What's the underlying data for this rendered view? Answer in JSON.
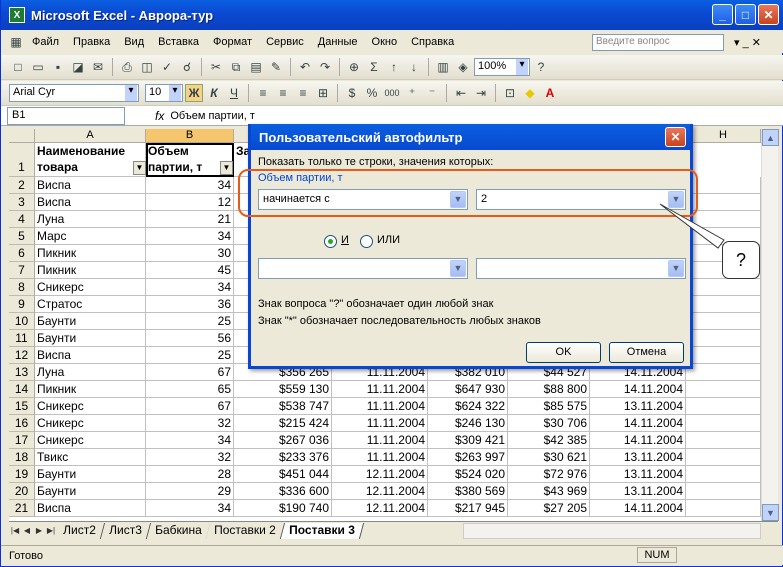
{
  "window": {
    "title": "Microsoft Excel - Аврора-тур"
  },
  "menu": {
    "items": [
      "Файл",
      "Правка",
      "Вид",
      "Вставка",
      "Формат",
      "Сервис",
      "Данные",
      "Окно",
      "Справка"
    ],
    "ask_placeholder": "Введите вопрос"
  },
  "toolbar": {
    "zoom": "100%",
    "font": "Arial Cyr",
    "size": "10",
    "bold": "Ж",
    "italic": "К",
    "underline": "Ч",
    "percent": "%",
    "thousands": "000"
  },
  "formula": {
    "cell": "B1",
    "fx": "fx",
    "content": "Объем партии, т"
  },
  "columns": [
    "A",
    "B",
    "H"
  ],
  "headers": {
    "a1a": "Наименование",
    "a1b": "товара",
    "b1a": "Объем",
    "b1b": "партии, т",
    "c1": "За"
  },
  "rows": [
    {
      "n": "1"
    },
    {
      "n": "2",
      "a": "Виспа",
      "b": "34"
    },
    {
      "n": "3",
      "a": "Виспа",
      "b": "12"
    },
    {
      "n": "4",
      "a": "Луна",
      "b": "21"
    },
    {
      "n": "5",
      "a": "Марс",
      "b": "34"
    },
    {
      "n": "6",
      "a": "Пикник",
      "b": "30"
    },
    {
      "n": "7",
      "a": "Пикник",
      "b": "45"
    },
    {
      "n": "8",
      "a": "Сникерс",
      "b": "34"
    },
    {
      "n": "9",
      "a": "Стратос",
      "b": "36"
    },
    {
      "n": "10",
      "a": "Баунти",
      "b": "25"
    },
    {
      "n": "11",
      "a": "Баунти",
      "b": "56"
    },
    {
      "n": "12",
      "a": "Виспа",
      "b": "25"
    },
    {
      "n": "13",
      "a": "Луна",
      "b": "67",
      "c": "$356 265",
      "d": "11.11.2004",
      "e": "$382 010",
      "f": "$44 527",
      "g": "14.11.2004"
    },
    {
      "n": "14",
      "a": "Пикник",
      "b": "65",
      "c": "$559 130",
      "d": "11.11.2004",
      "e": "$647 930",
      "f": "$88 800",
      "g": "14.11.2004"
    },
    {
      "n": "15",
      "a": "Сникерс",
      "b": "67",
      "c": "$538 747",
      "d": "11.11.2004",
      "e": "$624 322",
      "f": "$85 575",
      "g": "13.11.2004"
    },
    {
      "n": "16",
      "a": "Сникерс",
      "b": "32",
      "c": "$215 424",
      "d": "11.11.2004",
      "e": "$246 130",
      "f": "$30 706",
      "g": "14.11.2004"
    },
    {
      "n": "17",
      "a": "Сникерс",
      "b": "34",
      "c": "$267 036",
      "d": "11.11.2004",
      "e": "$309 421",
      "f": "$42 385",
      "g": "14.11.2004"
    },
    {
      "n": "18",
      "a": "Твикс",
      "b": "32",
      "c": "$233 376",
      "d": "11.11.2004",
      "e": "$263 997",
      "f": "$30 621",
      "g": "13.11.2004"
    },
    {
      "n": "19",
      "a": "Баунти",
      "b": "28",
      "c": "$451 044",
      "d": "12.11.2004",
      "e": "$524 020",
      "f": "$72 976",
      "g": "13.11.2004"
    },
    {
      "n": "20",
      "a": "Баунти",
      "b": "29",
      "c": "$336 600",
      "d": "12.11.2004",
      "e": "$380 569",
      "f": "$43 969",
      "g": "13.11.2004"
    },
    {
      "n": "21",
      "a": "Виспа",
      "b": "34",
      "c": "$190 740",
      "d": "12.11.2004",
      "e": "$217 945",
      "f": "$27 205",
      "g": "14.11.2004"
    }
  ],
  "sheets": [
    "Лист2",
    "Лист3",
    "Бабкина",
    "Поставки 2",
    "Поставки 3"
  ],
  "status": {
    "left": "Готово",
    "num": "NUM"
  },
  "dialog": {
    "title": "Пользовательский автофильтр",
    "prompt": "Показать только те строки, значения которых:",
    "field": "Объем партии, т",
    "op1": "начинается с",
    "val1": "2",
    "and": "И",
    "or": "ИЛИ",
    "hint1": "Знак вопроса \"?\" обозначает один любой знак",
    "hint2": "Знак \"*\" обозначает последовательность любых знаков",
    "ok": "OK",
    "cancel": "Отмена"
  },
  "callout": "?"
}
